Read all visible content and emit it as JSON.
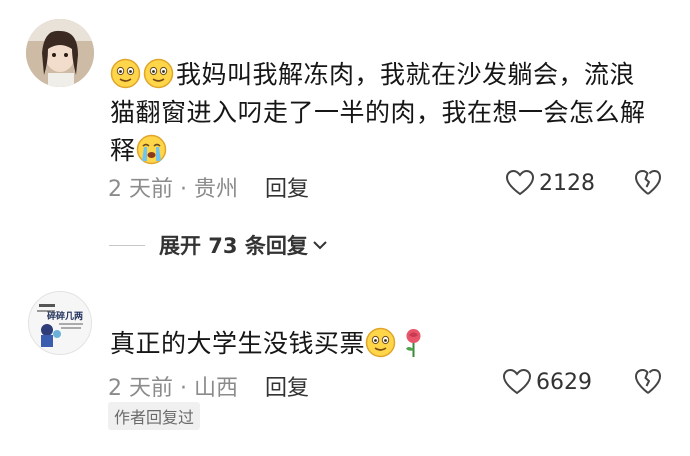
{
  "comments": [
    {
      "text_pre": "我妈叫我解冻肉，我就在沙发躺会，流浪猫翻窗进入叼走了一半的肉，我在想一会怎么解释",
      "meta": "2 天前 · 贵州",
      "reply_label": "回复",
      "likes": "2128"
    },
    {
      "text_pre": "真正的大学生没钱买票",
      "meta": "2 天前 · 山西",
      "reply_label": "回复",
      "likes": "6629",
      "badge": "作者回复过"
    }
  ],
  "thread": {
    "expand_label": "展开 73 条回复"
  },
  "avatar2_logo_text": "碎碎几两",
  "icons": [
    "heart-outline-icon",
    "broken-heart-icon",
    "chevron-down-icon",
    "smiling-emoji-icon",
    "crying-emoji-icon",
    "rose-emoji-icon"
  ]
}
